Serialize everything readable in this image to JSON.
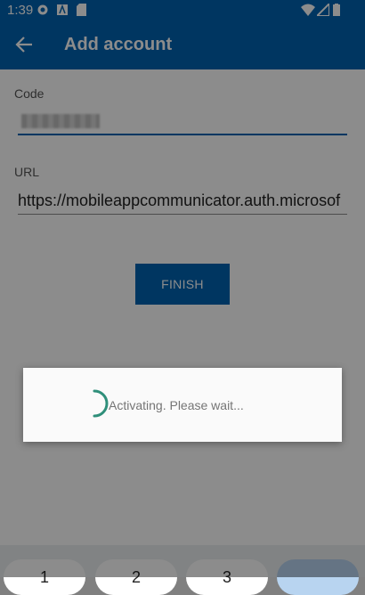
{
  "status_bar": {
    "time": "1:39",
    "icons": [
      "gear-icon",
      "a-icon",
      "sd-card-icon",
      "wifi-icon",
      "signal-icon",
      "battery-icon"
    ]
  },
  "app_bar": {
    "title": "Add account",
    "back_icon": "arrow-back-icon"
  },
  "form": {
    "code_label": "Code",
    "code_value_redacted": true,
    "url_label": "URL",
    "url_value": "https://mobileappcommunicator.auth.microsof",
    "finish_label": "FINISH"
  },
  "keyboard": {
    "keys": [
      "1",
      "2",
      "3"
    ]
  },
  "dialog": {
    "message": "Activating. Please wait..."
  },
  "colors": {
    "brand": "#0063b1",
    "spinner": "#2f8f7a"
  }
}
